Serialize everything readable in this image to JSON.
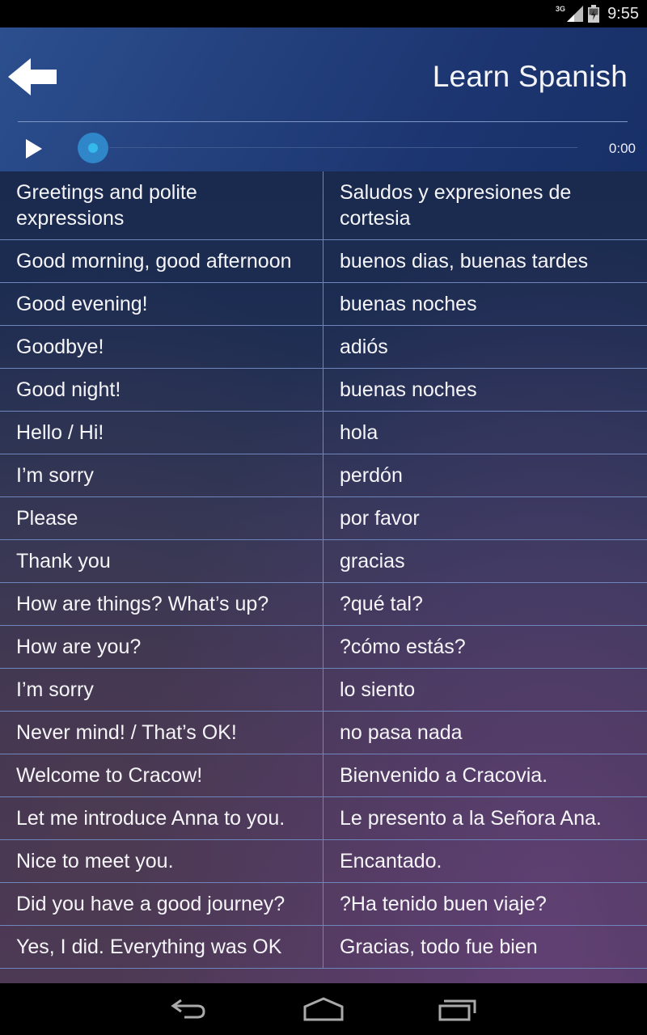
{
  "status_bar": {
    "network": "3G",
    "signal_icon": "signal-icon",
    "battery_icon": "battery-charging-icon",
    "time": "9:55"
  },
  "header": {
    "back_icon": "arrow-left-icon",
    "title": "Learn Spanish"
  },
  "player": {
    "play_icon": "play-icon",
    "progress": 0,
    "elapsed": "0:00"
  },
  "phrases": [
    {
      "en": "Greetings and polite expressions",
      "es": "Saludos y expresiones de cortesia"
    },
    {
      "en": "Good morning, good afternoon",
      "es": "buenos dias, buenas tardes"
    },
    {
      "en": "Good evening!",
      "es": "buenas noches"
    },
    {
      "en": "Goodbye!",
      "es": "adiós"
    },
    {
      "en": "Good night!",
      "es": "buenas noches"
    },
    {
      "en": "Hello / Hi!",
      "es": "hola"
    },
    {
      "en": "I’m sorry",
      "es": "perdón"
    },
    {
      "en": "Please",
      "es": "por favor"
    },
    {
      "en": "Thank you",
      "es": "gracias"
    },
    {
      "en": "How are things? What’s up?",
      "es": "?qué tal?"
    },
    {
      "en": "How are you?",
      "es": "?cómo estás?"
    },
    {
      "en": "I’m sorry",
      "es": "lo siento"
    },
    {
      "en": "Never mind! / That’s OK!",
      "es": "no pasa nada"
    },
    {
      "en": "Welcome to Cracow!",
      "es": "Bienvenido a Cracovia."
    },
    {
      "en": "Let me introduce Anna to you.",
      "es": "Le presento a la Señora Ana."
    },
    {
      "en": "Nice to meet you.",
      "es": "Encantado."
    },
    {
      "en": "Did you have a good journey?",
      "es": "?Ha tenido buen viaje?"
    },
    {
      "en": "Yes, I did. Everything was OK",
      "es": "Gracias, todo fue bien"
    }
  ],
  "nav_bar": {
    "back_icon": "nav-back-icon",
    "home_icon": "nav-home-icon",
    "recents_icon": "nav-recents-icon"
  }
}
